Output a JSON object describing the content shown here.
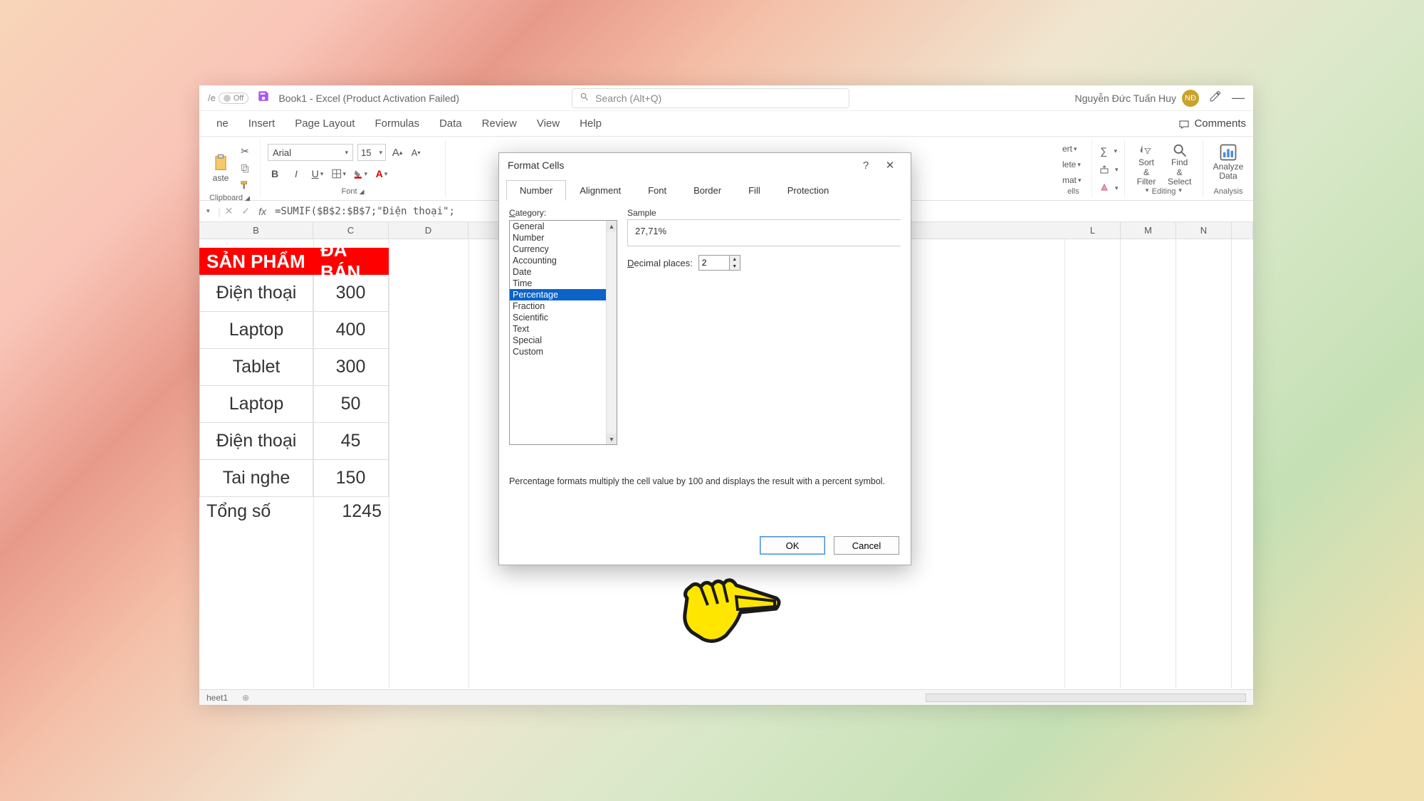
{
  "titlebar": {
    "autosave_off": "Off",
    "doc_title": "Book1  -  Excel (Product Activation Failed)",
    "search_placeholder": "Search (Alt+Q)",
    "user_name": "Nguyễn Đức Tuấn Huy",
    "avatar_initials": "NĐ"
  },
  "menu": {
    "tabs": [
      "ne",
      "Insert",
      "Page Layout",
      "Formulas",
      "Data",
      "Review",
      "View",
      "Help"
    ],
    "comments": "Comments"
  },
  "ribbon": {
    "clipboard": "Clipboard",
    "paste": "aste",
    "font_group": "Font",
    "font_name": "Arial",
    "font_size": "15",
    "right1_label1": "ert",
    "right1_label2": "lete",
    "right1_label3": "mat",
    "right1_group": "ells",
    "sort_filter": "Sort & Filter",
    "find_select": "Find & Select",
    "editing": "Editing",
    "analyze": "Analyze Data",
    "analysis": "Analysis"
  },
  "formula_bar": {
    "fx": "fx",
    "text": "=SUMIF($B$2:$B$7;\"Điện thoại\";"
  },
  "columns": [
    "B",
    "C",
    "D",
    "L",
    "M",
    "N"
  ],
  "table": {
    "h1": "SẢN PHẨM",
    "h2": "ĐÃ BÁN",
    "rows": [
      {
        "b": "Điện thoại",
        "c": "300"
      },
      {
        "b": "Laptop",
        "c": "400"
      },
      {
        "b": "Tablet",
        "c": "300"
      },
      {
        "b": "Laptop",
        "c": "50"
      },
      {
        "b": "Điện thoại",
        "c": "45"
      },
      {
        "b": "Tai nghe",
        "c": "150"
      }
    ],
    "total_label": "Tổng số",
    "total_value": "1245"
  },
  "dialog": {
    "title": "Format Cells",
    "tabs": [
      "Number",
      "Alignment",
      "Font",
      "Border",
      "Fill",
      "Protection"
    ],
    "active_tab": "Number",
    "category_label": "Category:",
    "categories": [
      "General",
      "Number",
      "Currency",
      "Accounting",
      "Date",
      "Time",
      "Percentage",
      "Fraction",
      "Scientific",
      "Text",
      "Special",
      "Custom"
    ],
    "selected_category": "Percentage",
    "sample_label": "Sample",
    "sample_value": "27,71%",
    "decimal_label": "Decimal places:",
    "decimal_value": "2",
    "description": "Percentage formats multiply the cell value by 100 and displays the result with a percent symbol.",
    "ok": "OK",
    "cancel": "Cancel"
  },
  "sheet": {
    "name": "heet1"
  }
}
